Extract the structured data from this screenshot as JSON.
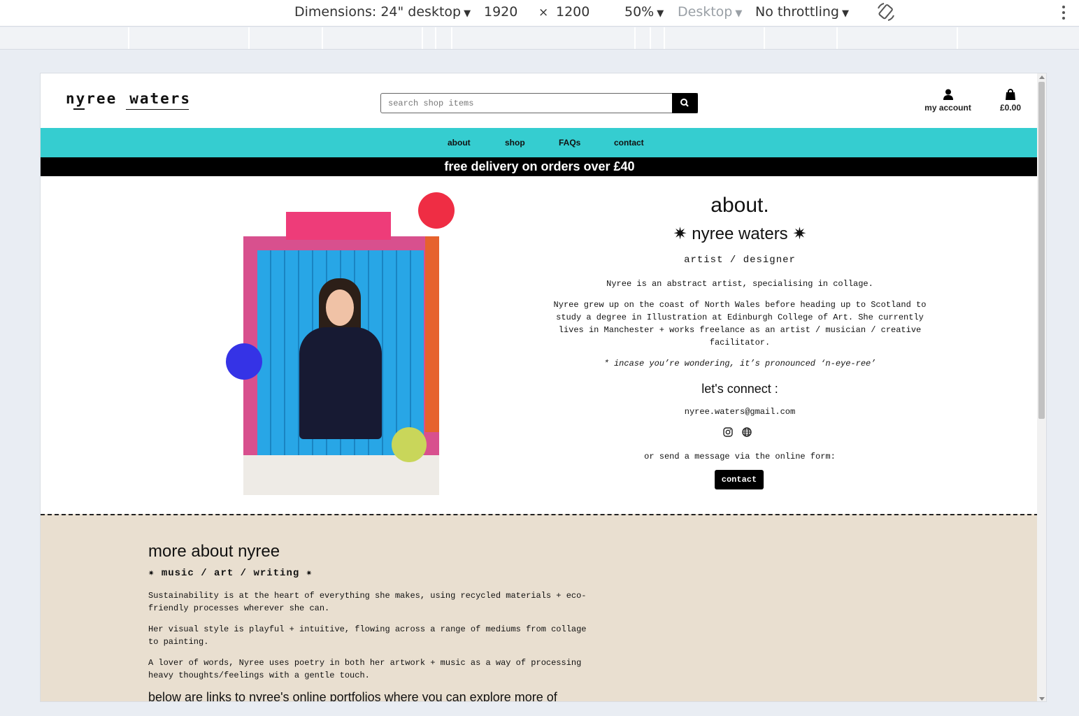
{
  "devtools": {
    "dimensions": "Dimensions: 24\" desktop",
    "width": "1920",
    "times": "×",
    "height": "1200",
    "zoom": "50%",
    "device_type": "Desktop",
    "throttling": "No throttling"
  },
  "site": {
    "logo_first": "nyree",
    "logo_last": "waters",
    "search_placeholder": "search shop items",
    "account_label": "my account",
    "cart_total": "£0.00",
    "nav": [
      "about",
      "shop",
      "FAQs",
      "contact"
    ],
    "promo": "free delivery on orders over £40"
  },
  "about": {
    "heading": "about.",
    "name": "✷ nyree waters ✷",
    "role": "artist / designer",
    "intro": "Nyree is an abstract artist, specialising in collage.",
    "bio": "Nyree grew up on the coast of North Wales before heading up to Scotland to study a degree in Illustration at Edinburgh College of Art. She currently lives in Manchester + works freelance as an artist / musician / creative facilitator.",
    "pronunciation": "* incase you’re wondering, it’s pronounced ‘n-eye-ree’",
    "connect_heading": "let's connect :",
    "email": "nyree.waters@gmail.com",
    "social_icons": [
      "instagram-icon",
      "globe-icon"
    ],
    "form_prompt": "or send a message via the online form:",
    "contact_button": "contact"
  },
  "more": {
    "heading": "more about nyree",
    "tags": "✷ music / art / writing ✷",
    "p1": "Sustainability is at the heart of everything she makes, using recycled materials + eco-friendly processes wherever she can.",
    "p2": "Her visual style is playful + intuitive, flowing across a range of mediums from collage to painting.",
    "p3": "A lover of words, Nyree uses poetry in both her artwork + music as a way of processing heavy thoughts/feelings with a gentle touch.",
    "links_heading": "below are links to nyree's online portfolios where you can explore more of"
  },
  "colors": {
    "nav_teal": "#35cdd0",
    "promo_black": "#000000",
    "more_bg": "#e9dfd0",
    "dot_red": "#ef2d44",
    "dot_blue": "#3533e6",
    "dot_lime": "#c9d65a",
    "tape_pink": "#ee3c79"
  }
}
